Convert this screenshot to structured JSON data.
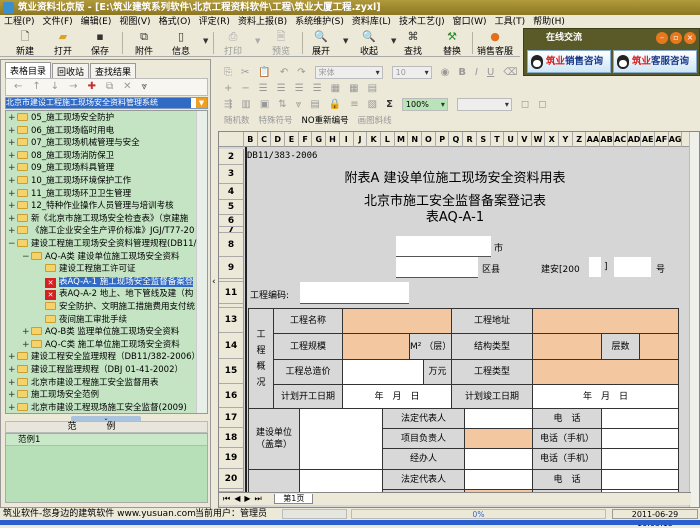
{
  "window": {
    "title": "筑业资料北京版 - [E:\\筑业建筑系列软件\\北京工程资料软件\\工程\\筑业大厦工程.zyxl]"
  },
  "menu": [
    "工程(P)",
    "文件(F)",
    "编辑(E)",
    "视图(V)",
    "格式(O)",
    "评定(R)",
    "资料上报(B)",
    "系统维护(S)",
    "资料库(L)",
    "技术工艺(J)",
    "窗口(W)",
    "工具(T)",
    "帮助(H)"
  ],
  "toolbar": {
    "new": "新建",
    "open": "打开",
    "save": "保存",
    "attach": "附件",
    "info": "信息",
    "print": "打印",
    "preview": "预览",
    "expand": "展开",
    "collapse": "收起",
    "find": "查找",
    "replace": "替换",
    "sales": "销售客服"
  },
  "chat": {
    "title": "在线交流",
    "sales_brand": "筑业",
    "sales_label": "销售咨询",
    "service_brand": "筑业",
    "service_label": "客服咨询"
  },
  "left": {
    "tabs": [
      "表格目录",
      "回收站",
      "查找结果"
    ],
    "combo": "北京市建设工程施工现场安全资料管理系统",
    "tree": [
      {
        "level": 0,
        "exp": "+",
        "icon": "folder",
        "label": "05_施工现场安全防护"
      },
      {
        "level": 0,
        "exp": "+",
        "icon": "folder",
        "label": "06_施工现场临时用电"
      },
      {
        "level": 0,
        "exp": "+",
        "icon": "folder",
        "label": "07_施工现场机械管理与安全"
      },
      {
        "level": 0,
        "exp": "+",
        "icon": "folder",
        "label": "08_施工现场消防保卫"
      },
      {
        "level": 0,
        "exp": "+",
        "icon": "folder",
        "label": "09_施工现场料具管理"
      },
      {
        "level": 0,
        "exp": "+",
        "icon": "folder",
        "label": "10_施工现场环境保护工作"
      },
      {
        "level": 0,
        "exp": "+",
        "icon": "folder",
        "label": "11_施工现场环卫卫生管理"
      },
      {
        "level": 0,
        "exp": "+",
        "icon": "folder",
        "label": "12_特种作业操作人员管理与培训考核"
      },
      {
        "level": 0,
        "exp": "+",
        "icon": "folder",
        "label": "新《北京市施工现场安全检查表》（京建施"
      },
      {
        "level": 0,
        "exp": "+",
        "icon": "folder",
        "label": "《施工企业安全生产评价标准》JGJ/T77-20"
      },
      {
        "level": 0,
        "exp": "-",
        "icon": "folder-open",
        "label": "建设工程施工现场安全资料管理规程(DB11/"
      },
      {
        "level": 1,
        "exp": "-",
        "icon": "folder-open",
        "label": "AQ-A类 建设单位施工现场安全资料"
      },
      {
        "level": 2,
        "exp": "",
        "icon": "folder",
        "label": "建设工程施工许可证"
      },
      {
        "level": 2,
        "exp": "",
        "icon": "red",
        "label": "表AQ-A-1 施工现场安全监督备案登",
        "selected": true
      },
      {
        "level": 2,
        "exp": "",
        "icon": "red",
        "label": "表AQ-A-2 地上、地下管线及建（构"
      },
      {
        "level": 2,
        "exp": "",
        "icon": "folder",
        "label": "安全防护、文明施工措施费用支付统"
      },
      {
        "level": 2,
        "exp": "",
        "icon": "folder",
        "label": "夜间施工审批手续"
      },
      {
        "level": 1,
        "exp": "+",
        "icon": "folder",
        "label": "AQ-B类 监理单位施工现场安全资料"
      },
      {
        "level": 1,
        "exp": "+",
        "icon": "folder",
        "label": "AQ-C类 施工单位施工现场安全资料"
      },
      {
        "level": 0,
        "exp": "+",
        "icon": "folder",
        "label": "建设工程安全监理规程（DB11/382-2006）"
      },
      {
        "level": 0,
        "exp": "+",
        "icon": "folder",
        "label": "建设工程监理规程（DBJ 01-41-2002）"
      },
      {
        "level": 0,
        "exp": "+",
        "icon": "folder",
        "label": "北京市建设工程施工安全监督用表"
      },
      {
        "level": 0,
        "exp": "+",
        "icon": "folder",
        "label": "施工现场安全范例"
      },
      {
        "level": 0,
        "exp": "+",
        "icon": "folder",
        "label": "北京市建设工程现场施工安全监督(2009)"
      }
    ],
    "examples_header": "范例",
    "examples": [
      "范例1"
    ]
  },
  "format": {
    "font": "宋体",
    "size": "10",
    "zoom": "100%",
    "random": "随机数",
    "special": "特殊符号",
    "renumber": "NO重新编号",
    "diag": "画图斜线"
  },
  "sheet": {
    "columns": [
      "B",
      "C",
      "D",
      "E",
      "F",
      "G",
      "H",
      "I",
      "J",
      "K",
      "L",
      "M",
      "N",
      "O",
      "P",
      "Q",
      "R",
      "S",
      "T",
      "U",
      "V",
      "W",
      "X",
      "Y",
      "Z",
      "AA",
      "AB",
      "AC",
      "AD",
      "AE",
      "AF",
      "AG"
    ],
    "rows": [
      "2",
      "3",
      "4",
      "5",
      "6",
      "7",
      "8",
      "9",
      "",
      "11",
      "",
      "13",
      "14",
      "15",
      "16",
      "17",
      "18",
      "19",
      "20",
      ""
    ],
    "code": "DB11/383-2006",
    "title1": "附表A 建设单位施工现场安全资料用表",
    "title2": "北京市施工安全监督备案登记表",
    "title3": "表AQ-A-1",
    "city": "市",
    "district": "区县",
    "jianan": "建安[200",
    "bracket": "]",
    "hao": "号",
    "project_code": "工程编码:",
    "overview": "工程概况",
    "name": "工程名称",
    "address": "工程地址",
    "scale": "工程规模",
    "scale_unit": "M² （层）",
    "structure": "结构类型",
    "floors": "层数",
    "cost": "工程总造价",
    "cost_unit": "万元",
    "type": "工程类型",
    "start": "计划开工日期",
    "date": "年　月　日",
    "finish": "计划竣工日期",
    "builder": "建设单位（盖章）",
    "legal": "法定代表人",
    "phone": "电　话",
    "manager": "项目负责人",
    "mobile": "电话（手机）",
    "handler": "经办人",
    "sheet_tab": "第1页"
  },
  "status": {
    "slogan": "筑业软件-您身边的建筑软件 www.yusuan.com",
    "user": "当前用户：管理员",
    "progress": "0%",
    "progress_value": 0,
    "datetime": "2011-06-29 16:03:15"
  }
}
